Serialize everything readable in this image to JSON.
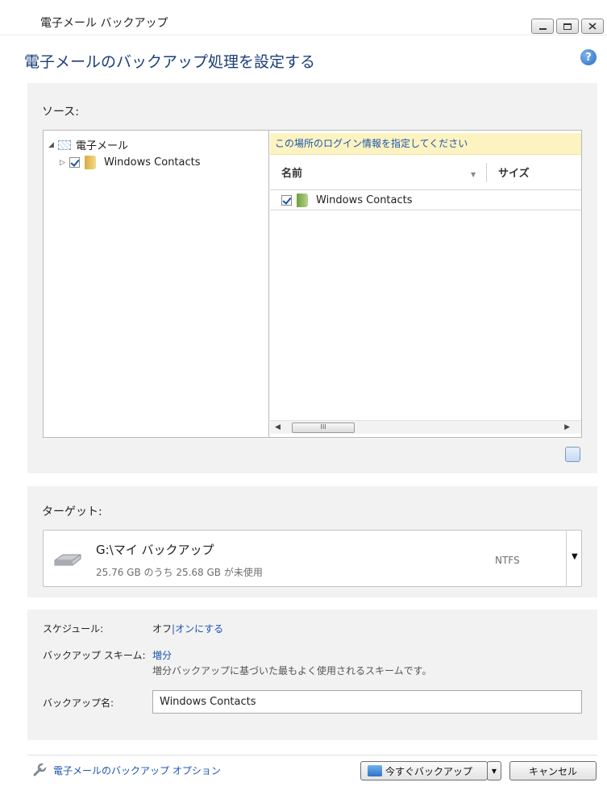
{
  "window": {
    "title": "電子メール バックアップ"
  },
  "heading": "電子メールのバックアップ処理を設定する",
  "help_icon": "help-icon",
  "source": {
    "label": "ソース:",
    "tree": {
      "root_label": "電子メール",
      "child_label": "Windows Contacts",
      "child_checked": true
    },
    "login_notice": "この場所のログイン情報を指定してください",
    "columns": {
      "name": "名前",
      "size": "サイズ"
    },
    "rows": [
      {
        "name": "Windows Contacts",
        "checked": true
      }
    ],
    "scroll_thumb": "III"
  },
  "target": {
    "label": "ターゲット:",
    "path": "G:\\マイ バックアップ",
    "capacity": "25.76 GB のうち 25.68 GB が未使用",
    "filesystem": "NTFS",
    "dropdown_glyph": "▼"
  },
  "settings": {
    "schedule_label": "スケジュール:",
    "schedule_value": "オフ",
    "schedule_separator": "|",
    "schedule_link": "オンにする",
    "scheme_label": "バックアップ スキーム:",
    "scheme_value": "増分",
    "scheme_desc": "増分バックアップに基づいた最もよく使用されるスキームです。",
    "name_label": "バックアップ名:",
    "name_value": "Windows Contacts"
  },
  "footer": {
    "options_link": "電子メールのバックアップ オプション",
    "backup_button": "今すぐバックアップ",
    "cancel_button": "キャンセル"
  },
  "colors": {
    "link": "#1c54b0",
    "heading": "#1b3f7a",
    "notice_bg": "#fdf3c0",
    "panel_bg": "#f2f2f2"
  }
}
